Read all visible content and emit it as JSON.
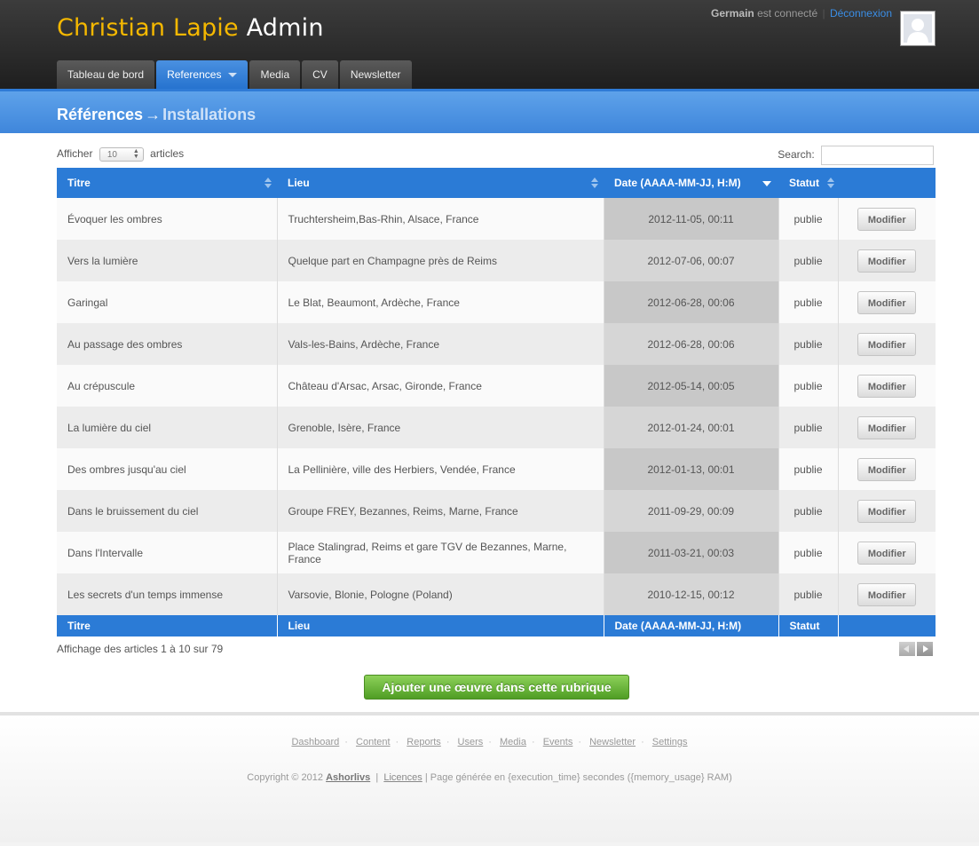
{
  "header": {
    "brand_name": "Christian Lapie",
    "brand_suffix": "Admin",
    "user_name": "Germain",
    "user_status": "est connecté",
    "logout_label": "Déconnexion",
    "nav": [
      {
        "label": "Tableau de bord"
      },
      {
        "label": "References",
        "active": true
      },
      {
        "label": "Media"
      },
      {
        "label": "CV"
      },
      {
        "label": "Newsletter"
      }
    ]
  },
  "breadcrumb": {
    "section": "Références",
    "arrow": "→",
    "page": "Installations"
  },
  "table_controls": {
    "show_label": "Afficher",
    "page_size": "10",
    "items_label": "articles",
    "search_label": "Search:",
    "search_value": ""
  },
  "table": {
    "headers": [
      "Titre",
      "Lieu",
      "Date (AAAA-MM-JJ, H:M)",
      "Statut",
      ""
    ],
    "rows": [
      {
        "titre": "Évoquer les ombres",
        "lieu": "Truchtersheim,Bas-Rhin, Alsace, France",
        "date": "2012-11-05, 00:11",
        "statut": "publie",
        "action": "Modifier"
      },
      {
        "titre": "Vers la lumière",
        "lieu": "Quelque part en Champagne près de Reims",
        "date": "2012-07-06, 00:07",
        "statut": "publie",
        "action": "Modifier"
      },
      {
        "titre": "Garingal",
        "lieu": "Le Blat, Beaumont, Ardèche, France",
        "date": "2012-06-28, 00:06",
        "statut": "publie",
        "action": "Modifier"
      },
      {
        "titre": "Au passage des ombres",
        "lieu": "Vals-les-Bains, Ardèche, France",
        "date": "2012-06-28, 00:06",
        "statut": "publie",
        "action": "Modifier"
      },
      {
        "titre": "Au crépuscule",
        "lieu": "Château d'Arsac, Arsac, Gironde, France",
        "date": "2012-05-14, 00:05",
        "statut": "publie",
        "action": "Modifier"
      },
      {
        "titre": "La lumière du ciel",
        "lieu": "Grenoble, Isère, France",
        "date": "2012-01-24, 00:01",
        "statut": "publie",
        "action": "Modifier"
      },
      {
        "titre": "Des ombres jusqu'au ciel",
        "lieu": "La Pellinière, ville des Herbiers, Vendée, France",
        "date": "2012-01-13, 00:01",
        "statut": "publie",
        "action": "Modifier"
      },
      {
        "titre": "Dans le bruissement du ciel",
        "lieu": "Groupe FREY, Bezannes, Reims, Marne, France",
        "date": "2011-09-29, 00:09",
        "statut": "publie",
        "action": "Modifier"
      },
      {
        "titre": "Dans l'Intervalle",
        "lieu": "Place Stalingrad, Reims et gare TGV de Bezannes, Marne, France",
        "date": "2011-03-21, 00:03",
        "statut": "publie",
        "action": "Modifier"
      },
      {
        "titre": "Les secrets d'un temps immense",
        "lieu": "Varsovie, Blonie, Pologne (Poland)",
        "date": "2010-12-15, 00:12",
        "statut": "publie",
        "action": "Modifier"
      }
    ]
  },
  "info": "Affichage des articles 1 à 10 sur 79",
  "add_button": "Ajouter une œuvre dans cette rubrique",
  "footer": {
    "links": [
      "Dashboard",
      "Content",
      "Reports",
      "Users",
      "Media",
      "Events",
      "Newsletter",
      "Settings"
    ],
    "copyright": "Copyright © 2012",
    "company": "Ashorlivs",
    "licence": "Licences",
    "generated": "| Page générée en {execution_time} secondes ({memory_usage} RAM)"
  },
  "colors": {
    "brand_accent": "#f5b800",
    "primary_blue": "#2b7bd6",
    "add_green": "#5aa82a"
  }
}
